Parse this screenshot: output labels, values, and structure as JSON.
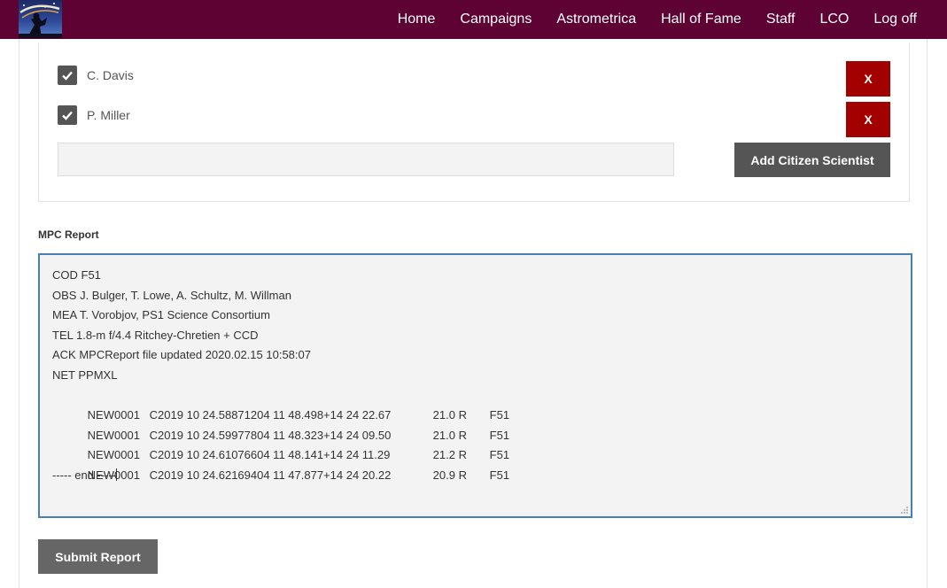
{
  "nav": {
    "logo_icon": "observatory-logo-icon",
    "items": [
      "Home",
      "Campaigns",
      "Astrometrica",
      "Hall of Fame",
      "Staff",
      "LCO",
      "Log off"
    ]
  },
  "colors": {
    "topbar": "#5e0234",
    "remove_button": "#a30000",
    "dark_button": "#555555",
    "textarea_border": "#4a7fb5"
  },
  "scientists": [
    {
      "name": "C. Davis",
      "checked": true,
      "remove_label": "X"
    },
    {
      "name": "P. Miller",
      "checked": true,
      "remove_label": "X"
    }
  ],
  "add_form": {
    "input_value": "",
    "button_label": "Add Citizen Scientist"
  },
  "report": {
    "title": "MPC Report",
    "header_lines": [
      "COD F51",
      "OBS J. Bulger, T. Lowe, A. Schultz, M. Willman",
      "MEA T. Vorobjov, PS1 Science Consortium",
      "TEL 1.8-m f/4.4 Ritchey-Chretien + CCD",
      "ACK MPCReport file updated 2020.02.15 10:58:07",
      "NET PPMXL"
    ],
    "observations": [
      {
        "id": "NEW0001",
        "data": "C2019 10 24.58871204 11 48.498+14 24 22.67",
        "mag": "21.0 R",
        "code": "F51"
      },
      {
        "id": "NEW0001",
        "data": "C2019 10 24.59977804 11 48.323+14 24 09.50",
        "mag": "21.0 R",
        "code": "F51"
      },
      {
        "id": "NEW0001",
        "data": "C2019 10 24.61076604 11 48.141+14 24 11.29",
        "mag": "21.2 R",
        "code": "F51"
      },
      {
        "id": "NEW0001",
        "data": "C2019 10 24.62169404 11 47.877+14 24 20.22",
        "mag": "20.9 R",
        "code": "F51"
      }
    ],
    "end_line": "----- end -----"
  },
  "submit_label": "Submit Report"
}
